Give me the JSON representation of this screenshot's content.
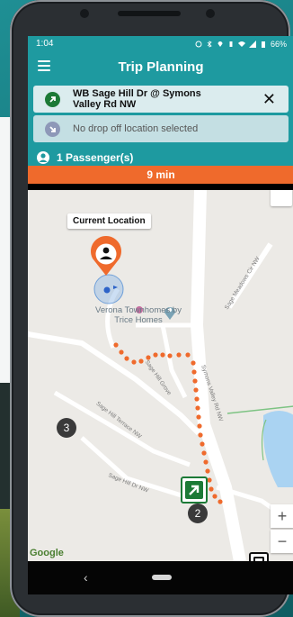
{
  "status_bar": {
    "time": "1:04",
    "battery": "66%"
  },
  "app_bar": {
    "title": "Trip Planning",
    "menu_icon": "hamburger-menu-icon"
  },
  "pickup": {
    "label": "WB Sage Hill Dr @ Symons Valley Rd NW",
    "icon": "pickup-arrow-icon",
    "clear_icon": "close-icon"
  },
  "dropoff": {
    "placeholder": "No drop off location selected",
    "icon": "dropoff-arrow-icon"
  },
  "passengers": {
    "label": "1 Passenger(s)",
    "icon": "person-icon"
  },
  "eta": {
    "label": "9 min"
  },
  "map": {
    "callout": "Current Location",
    "poi": "Verona Townhomes by Trice Homes",
    "streets": [
      "Sage Hill Grove",
      "Symons Valley Rd NW",
      "Sage Hill Terrace NW",
      "Sage Hill Dr NW",
      "Sage Meadows Cir NW"
    ],
    "cluster_labels": [
      "3",
      "2"
    ],
    "attribution": "Google",
    "zoom_in": "+",
    "zoom_out": "−"
  },
  "colors": {
    "teal": "#1e9aa0",
    "orange": "#ef6a2c",
    "stop_green": "#1c7a36"
  }
}
